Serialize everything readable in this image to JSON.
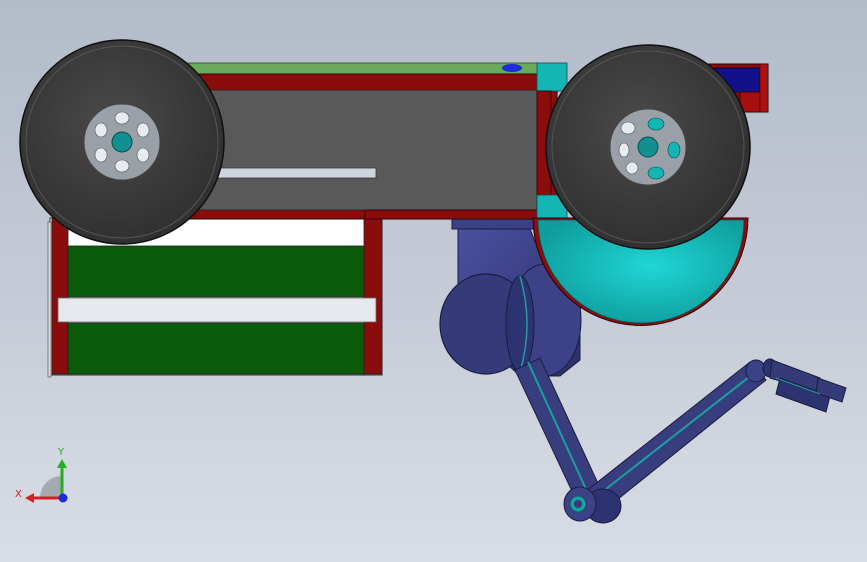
{
  "viewport": {
    "background_top": "#b3bbc9",
    "background_bottom": "#d9dde5"
  },
  "triad": {
    "x_label": "X",
    "y_label": "Y",
    "x_color": "#d42020",
    "y_color": "#22b022",
    "z_color": "#1b2bd6"
  },
  "colors": {
    "frame_red": "#8a0c0c",
    "body_grey": "#595959",
    "tire": "#3a3a3a",
    "rim": "#9aa0a8",
    "hub_teal": "#128f8f",
    "cyan_part": "#13c0c0",
    "green_panel": "#0a5c0a",
    "top_green": "#6aaa5a",
    "arm_navy": "#353a78",
    "arm_edge": "#1aa0a0"
  },
  "components": [
    "main-chassis",
    "left-wheel",
    "right-wheel",
    "battery-pack",
    "gear-housing",
    "robotic-arm",
    "gripper"
  ]
}
